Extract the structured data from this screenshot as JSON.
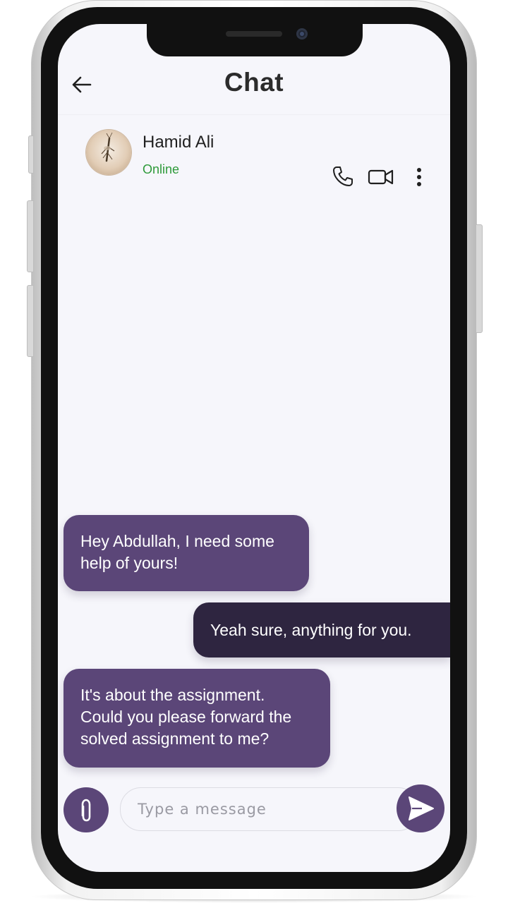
{
  "header": {
    "title": "Chat",
    "back_icon": "arrow-left-icon"
  },
  "contact": {
    "name": "Hamid Ali",
    "status": "Online",
    "status_color": "#2e9a3a",
    "actions": [
      {
        "icon": "phone-icon"
      },
      {
        "icon": "video-camera-icon"
      },
      {
        "icon": "more-vertical-icon"
      }
    ]
  },
  "messages": [
    {
      "direction": "incoming",
      "lines": [
        "Hey Abdullah, I need some",
        "help of yours!"
      ]
    },
    {
      "direction": "outgoing",
      "lines": [
        "Yeah sure, anything for you."
      ]
    },
    {
      "direction": "incoming",
      "lines": [
        "It's about the assignment.",
        "Could you please forward the",
        "solved assignment to me?"
      ]
    }
  ],
  "composer": {
    "placeholder": "Type a message",
    "attach_icon": "paperclip-icon",
    "send_icon": "send-icon"
  },
  "colors": {
    "accent": "#5b4678",
    "outgoing_bubble": "#2e2540",
    "screen_background": "#f6f6fb"
  }
}
